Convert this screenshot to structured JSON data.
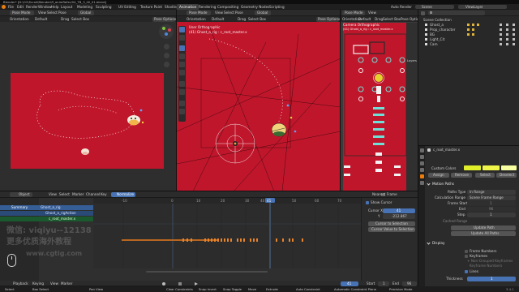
{
  "window_title": "Blender* [D:\\CG\\Scroll\\Blender\\ff_animRefer/04_TB_3_l0l_01.blend]",
  "menus": [
    "File",
    "Edit",
    "Render",
    "Window",
    "Help"
  ],
  "workspaces": [
    "Layout",
    "Modeling",
    "Sculpting",
    "UV Editing",
    "Texture Paint",
    "Shading",
    "Animation",
    "Rendering",
    "Compositing",
    "Geometry Nodes",
    "Scripting"
  ],
  "active_workspace": "Animation",
  "top_right": {
    "auto_render": "Auto Render",
    "scene": "Scene",
    "view_layer": "ViewLayer"
  },
  "viewport_left": {
    "mode": "Pose Mode",
    "view": "View",
    "select": "Select",
    "pose": "Pose",
    "transform": "Global",
    "orientation_label": "Orientation",
    "orientation": "Default",
    "drag_label": "Drag",
    "drag": "Select Box",
    "pose_options": "Pose Options"
  },
  "viewport_center": {
    "mode": "Pose Mode",
    "view": "View",
    "select": "Select",
    "pose": "Pose",
    "transform": "Global",
    "orientation_label": "Orientation",
    "orientation": "Default",
    "drag_label": "Drag",
    "drag": "Select Box",
    "pose_options": "Pose Options",
    "overlay_title": "User Orthographic",
    "overlay_subtitle": "(41) Ghost_a_rig : c_root_master.x"
  },
  "viewport_right": {
    "mode": "Pose Mode",
    "view": "View",
    "orientation_label": "Orientation",
    "orientation": "Default",
    "drag_label": "Drag",
    "drag": "Select Box",
    "pose_options": "Pose Options",
    "overlay_title": "Camera Orthographic",
    "overlay_subtitle": "(41) Ghost_a_rig : c_root_master.x",
    "side_label": "Layers"
  },
  "outliner": {
    "search_placeholder": "",
    "title": "Scene",
    "items": [
      "Scene Collection",
      "Ghost_a",
      "Prop_character",
      "BG",
      "Light_Cit",
      "Cam"
    ]
  },
  "properties": {
    "bone": "c_root_master.x",
    "color_set_label": "Custom Colors",
    "color_buttons": [
      "Assign",
      "Remove",
      "Select",
      "Deselect"
    ],
    "motion_paths_label": "Motion Paths",
    "paths_type_label": "Paths Type",
    "paths_type": "In Range",
    "calc_range_label": "Calculation Range",
    "calc_range": "Scene Frame Range",
    "frame_start_label": "Frame Start",
    "frame_start": "1",
    "end_label": "End",
    "end": "96",
    "step_label": "Step",
    "step": "1",
    "cache_range_label": "Cached Range",
    "update_path": "Update Path",
    "update_all": "Update All Paths",
    "display_label": "Display",
    "frame_numbers": "Frame Numbers",
    "keyframes": "Keyframes",
    "highlight": "+ Non-Grouped Keyframes",
    "keyframe_numbers": "Keyframe Numbers",
    "lines": "Lines",
    "thickness_label": "Thickness",
    "thickness": "1"
  },
  "dopesheet": {
    "mode": "Object",
    "menus": [
      "View",
      "Select",
      "Marker",
      "Channel",
      "Key"
    ],
    "normalize": "Normalize",
    "channels": [
      "Summary",
      "Ghost_a_rig",
      "Ghost_a_rigAction",
      "c_root_master.x"
    ],
    "frame_ticks": [
      "-10",
      "0",
      "10",
      "20",
      "30",
      "40",
      "50",
      "60",
      "70",
      "80",
      "90",
      "100",
      "110"
    ],
    "current_frame": "41",
    "side_tabs": [
      "Nearest Frame"
    ],
    "show_cursor": "Show Cursor",
    "cursor_x_label": "Cursor X",
    "cursor_x": "41",
    "cursor_y_label": "Y",
    "cursor_y": "-212.867",
    "cursor_to_selection": "Cursor to Selection",
    "cursor_value_to_selection": "Cursor Value to Selection"
  },
  "timeline": {
    "playback": "Playback",
    "keying": "Keying",
    "view": "View",
    "marker": "Marker",
    "current": "41",
    "start_label": "Start",
    "start": "1",
    "end_label": "End",
    "end": "96"
  },
  "status_bar": {
    "items": [
      "Select",
      "Box Select",
      "Pan View",
      "Clear Constraints",
      "Snap Invert",
      "Snap Toggle",
      "Move",
      "Extrude",
      "Auto Constraint",
      "Automatic Constraint Plane",
      "Precision Mode"
    ],
    "version": "3.4.1"
  },
  "watermark": {
    "line1": "微信: viqiyu--12138",
    "line2": "更多优质海外教程",
    "line3": "www.cgtig.com"
  },
  "colors": {
    "viewport_red": "#c0162b",
    "accent": "#4772b3",
    "orange": "#e7842c",
    "panel": "#2b2b2b"
  }
}
